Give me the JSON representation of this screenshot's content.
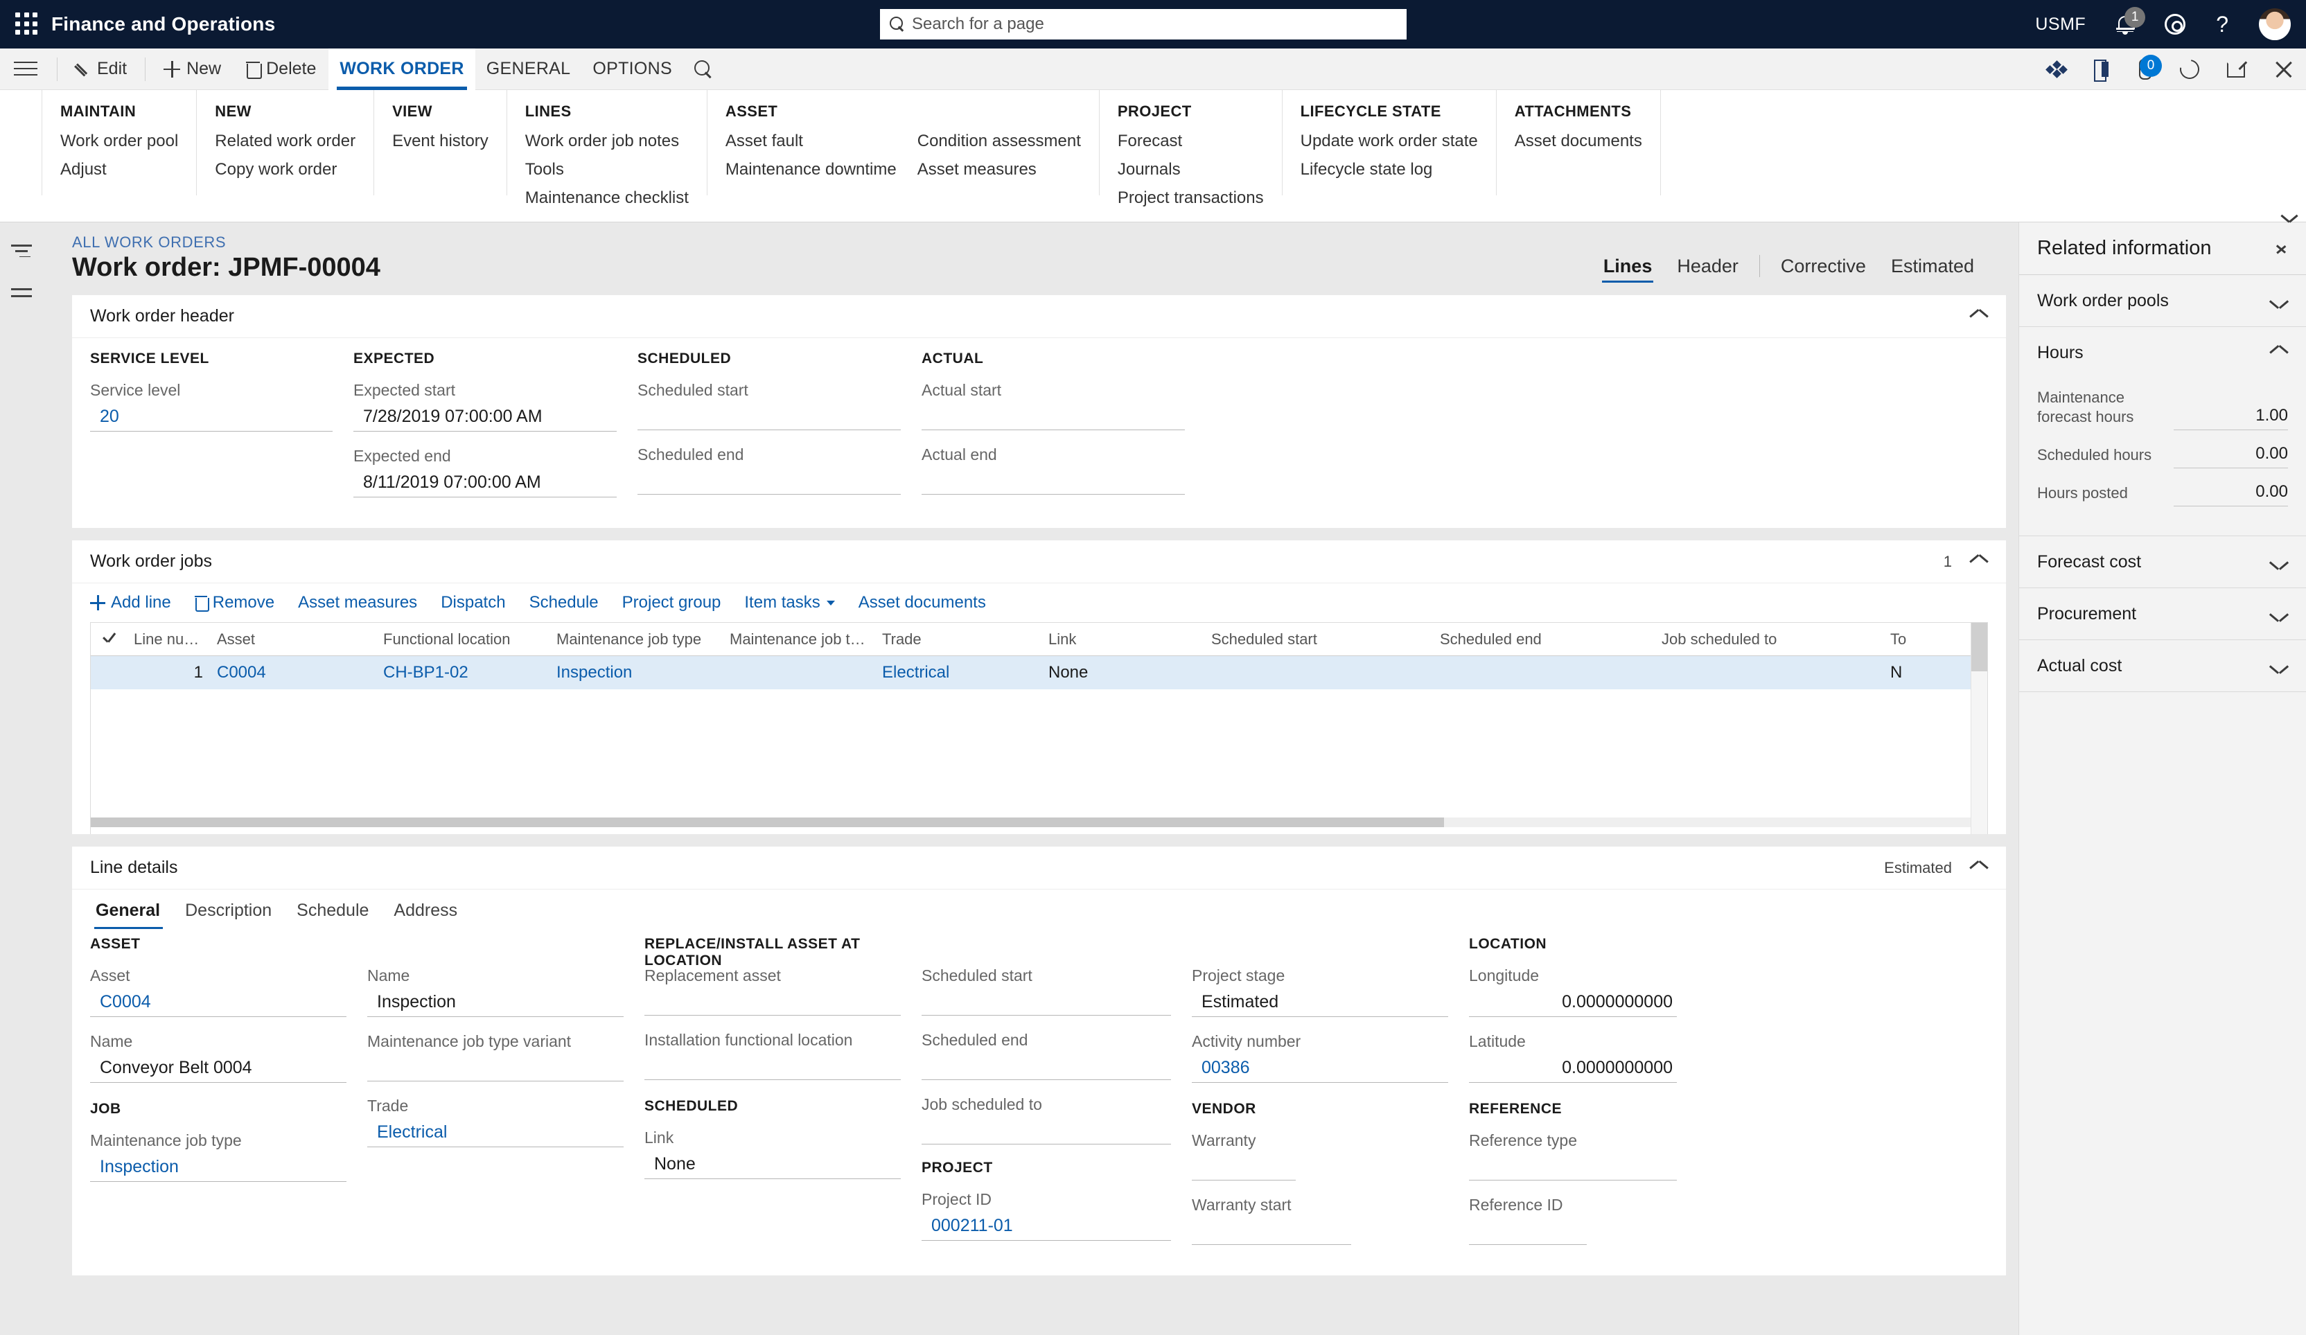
{
  "topbar": {
    "waffle_icon": "app-launcher-icon",
    "app_title": "Finance and Operations",
    "search_placeholder": "Search for a page",
    "company_id": "USMF",
    "notification_count": "1",
    "settings_icon": "gear-icon",
    "help_icon": "question-mark-icon",
    "avatar_icon": "user-avatar"
  },
  "actionpane": {
    "hamburger_icon": "hamburger-menu-icon",
    "edit_label": "Edit",
    "new_label": "New",
    "delete_label": "Delete",
    "tabs": [
      {
        "label": "WORK ORDER",
        "active": true
      },
      {
        "label": "GENERAL",
        "active": false
      },
      {
        "label": "OPTIONS",
        "active": false
      }
    ],
    "search_icon": "search-icon",
    "right_icons": [
      "relationships-icon",
      "office-icon",
      "attachments-icon",
      "refresh-icon",
      "popout-icon",
      "close-icon"
    ],
    "attachment_count": "0"
  },
  "ribbon": {
    "groups": [
      {
        "title": "MAINTAIN",
        "columns": [
          [
            "Work order pool",
            "Adjust"
          ]
        ]
      },
      {
        "title": "NEW",
        "columns": [
          [
            "Related work order",
            "Copy work order"
          ]
        ]
      },
      {
        "title": "VIEW",
        "columns": [
          [
            "Event history"
          ]
        ]
      },
      {
        "title": "LINES",
        "columns": [
          [
            "Work order job notes",
            "Tools",
            "Maintenance checklist"
          ]
        ]
      },
      {
        "title": "ASSET",
        "columns": [
          [
            "Asset fault",
            "Maintenance downtime"
          ],
          [
            "Condition assessment",
            "Asset measures"
          ]
        ]
      },
      {
        "title": "PROJECT",
        "columns": [
          [
            "Forecast",
            "Journals",
            "Project transactions"
          ]
        ]
      },
      {
        "title": "LIFECYCLE STATE",
        "columns": [
          [
            "Update work order state",
            "Lifecycle state log"
          ]
        ]
      },
      {
        "title": "ATTACHMENTS",
        "columns": [
          [
            "Asset documents"
          ]
        ]
      }
    ],
    "collapse_icon": "chevron-up-icon"
  },
  "leftrail": {
    "filter_icon": "filter-icon",
    "lines_icon": "list-lines-icon"
  },
  "page": {
    "breadcrumb": "ALL WORK ORDERS",
    "title": "Work order: JPMF-00004",
    "view_tabs": [
      {
        "label": "Lines",
        "active": true
      },
      {
        "label": "Header",
        "active": false
      },
      {
        "label": "Corrective",
        "active": false
      },
      {
        "label": "Estimated",
        "active": false
      }
    ]
  },
  "work_order_header": {
    "title": "Work order header",
    "collapse_icon": "chevron-up-icon",
    "columns": [
      {
        "heading": "SERVICE LEVEL",
        "fields": [
          {
            "label": "Service level",
            "value": "20",
            "link": true
          }
        ]
      },
      {
        "heading": "EXPECTED",
        "fields": [
          {
            "label": "Expected start",
            "value": "7/28/2019 07:00:00 AM",
            "link": false
          },
          {
            "label": "Expected end",
            "value": "8/11/2019 07:00:00 AM",
            "link": false
          }
        ]
      },
      {
        "heading": "SCHEDULED",
        "fields": [
          {
            "label": "Scheduled start",
            "value": "",
            "link": false
          },
          {
            "label": "Scheduled end",
            "value": "",
            "link": false
          }
        ]
      },
      {
        "heading": "ACTUAL",
        "fields": [
          {
            "label": "Actual start",
            "value": "",
            "link": false
          },
          {
            "label": "Actual end",
            "value": "",
            "link": false
          }
        ]
      }
    ]
  },
  "work_order_jobs": {
    "title": "Work order jobs",
    "count": "1",
    "collapse_icon": "chevron-up-icon",
    "toolbar": [
      {
        "label": "Add line",
        "icon": "plus-icon"
      },
      {
        "label": "Remove",
        "icon": "trash-icon"
      },
      {
        "label": "Asset measures",
        "icon": ""
      },
      {
        "label": "Dispatch",
        "icon": ""
      },
      {
        "label": "Schedule",
        "icon": ""
      },
      {
        "label": "Project group",
        "icon": ""
      },
      {
        "label": "Item tasks",
        "icon": "caret-down-icon"
      },
      {
        "label": "Asset documents",
        "icon": ""
      }
    ],
    "columns": [
      "Line number",
      "Asset",
      "Functional location",
      "Maintenance job type",
      "Maintenance job type varia...",
      "Trade",
      "Link",
      "Scheduled start",
      "Scheduled end",
      "Job scheduled to",
      "To"
    ],
    "rows": [
      {
        "line_number": "1",
        "asset": "C0004",
        "functional_location": "CH-BP1-02",
        "maintenance_job_type": "Inspection",
        "maintenance_job_type_variant": "",
        "trade": "Electrical",
        "link": "None",
        "scheduled_start": "",
        "scheduled_end": "",
        "job_scheduled_to": "",
        "to": "N"
      }
    ]
  },
  "line_details": {
    "title": "Line details",
    "status": "Estimated",
    "collapse_icon": "chevron-up-icon",
    "tabs": [
      {
        "label": "General",
        "active": true
      },
      {
        "label": "Description",
        "active": false
      },
      {
        "label": "Schedule",
        "active": false
      },
      {
        "label": "Address",
        "active": false
      }
    ],
    "columns": [
      {
        "blocks": [
          {
            "heading": "ASSET",
            "fields": [
              {
                "label": "Asset",
                "value": "C0004",
                "link": true
              },
              {
                "label": "Name",
                "value": "Conveyor Belt 0004",
                "link": false
              }
            ]
          },
          {
            "heading": "JOB",
            "fields": [
              {
                "label": "Maintenance job type",
                "value": "Inspection",
                "link": true
              }
            ]
          }
        ]
      },
      {
        "blocks": [
          {
            "heading": "",
            "fields": [
              {
                "label": "Name",
                "value": "Inspection",
                "link": false
              },
              {
                "label": "Maintenance job type variant",
                "value": "",
                "link": false
              },
              {
                "label": "Trade",
                "value": "Electrical",
                "link": true
              }
            ]
          }
        ]
      },
      {
        "blocks": [
          {
            "heading": "REPLACE/INSTALL ASSET AT LOCATION",
            "fields": [
              {
                "label": "Replacement asset",
                "value": "",
                "link": false
              },
              {
                "label": "Installation functional location",
                "value": "",
                "link": false
              }
            ]
          },
          {
            "heading": "SCHEDULED",
            "fields": [
              {
                "label": "Link",
                "value": "None",
                "link": false
              }
            ]
          }
        ]
      },
      {
        "blocks": [
          {
            "heading": "",
            "fields": [
              {
                "label": "Scheduled start",
                "value": "",
                "link": false
              },
              {
                "label": "Scheduled end",
                "value": "",
                "link": false
              },
              {
                "label": "Job scheduled to",
                "value": "",
                "link": false
              }
            ]
          },
          {
            "heading": "PROJECT",
            "fields": [
              {
                "label": "Project ID",
                "value": "000211-01",
                "link": true
              }
            ]
          }
        ]
      },
      {
        "blocks": [
          {
            "heading": "",
            "fields": [
              {
                "label": "Project stage",
                "value": "Estimated",
                "link": false
              },
              {
                "label": "Activity number",
                "value": "00386",
                "link": true
              }
            ]
          },
          {
            "heading": "VENDOR",
            "fields": [
              {
                "label": "Warranty",
                "value": "",
                "link": false
              },
              {
                "label": "Warranty start",
                "value": "",
                "link": false
              }
            ]
          }
        ]
      },
      {
        "blocks": [
          {
            "heading": "LOCATION",
            "fields": [
              {
                "label": "Longitude",
                "value": "0.0000000000",
                "link": false,
                "numeric": true
              },
              {
                "label": "Latitude",
                "value": "0.0000000000",
                "link": false,
                "numeric": true
              }
            ]
          },
          {
            "heading": "REFERENCE",
            "fields": [
              {
                "label": "Reference type",
                "value": "",
                "link": false
              },
              {
                "label": "Reference ID",
                "value": "",
                "link": false
              }
            ]
          }
        ]
      }
    ]
  },
  "factpane": {
    "title": "Related information",
    "expand_icon": "chevron-right-icon",
    "sections": [
      {
        "title": "Work order pools",
        "expanded": false,
        "icon": "chevron-down-icon",
        "rows": []
      },
      {
        "title": "Hours",
        "expanded": true,
        "icon": "chevron-up-icon",
        "rows": [
          {
            "label": "Maintenance forecast hours",
            "value": "1.00"
          },
          {
            "label": "Scheduled hours",
            "value": "0.00"
          },
          {
            "label": "Hours posted",
            "value": "0.00"
          }
        ]
      },
      {
        "title": "Forecast cost",
        "expanded": false,
        "icon": "chevron-down-icon",
        "rows": []
      },
      {
        "title": "Procurement",
        "expanded": false,
        "icon": "chevron-down-icon",
        "rows": []
      },
      {
        "title": "Actual cost",
        "expanded": false,
        "icon": "chevron-down-icon",
        "rows": []
      }
    ]
  },
  "colors": {
    "topbar_bg": "#0b1a33",
    "accent": "#0b5cab",
    "link": "#0b5cab",
    "row_selected": "#deebf7",
    "badge_blue": "#0078d4"
  }
}
